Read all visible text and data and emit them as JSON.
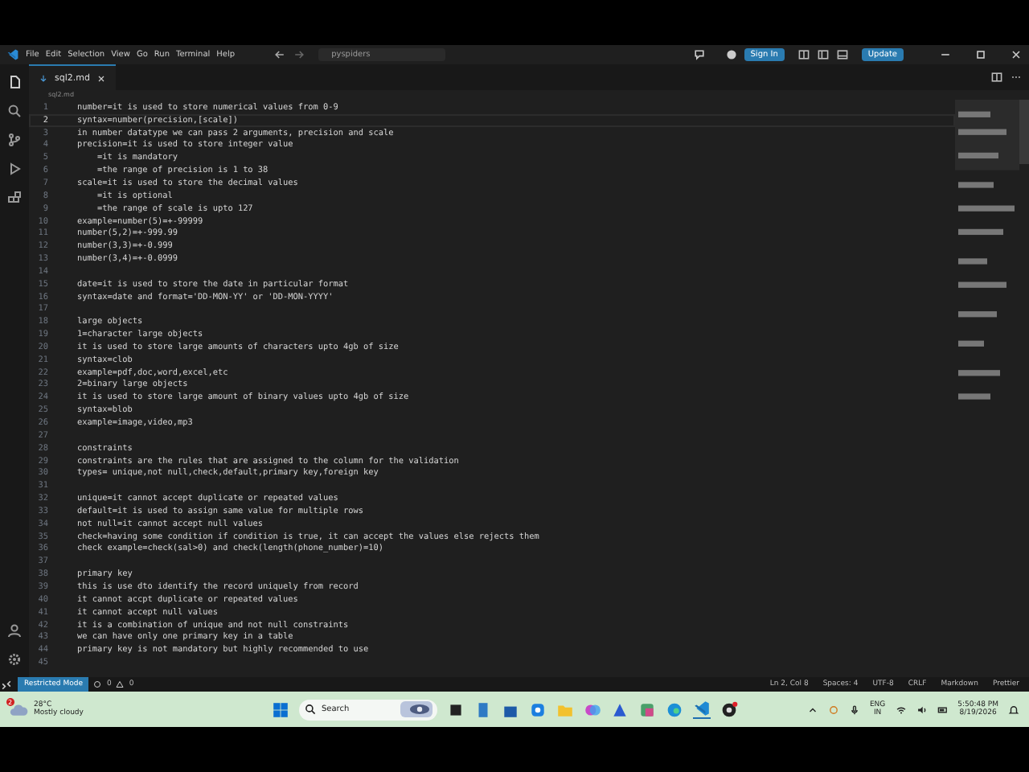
{
  "title_bar": {
    "menu": [
      "File",
      "Edit",
      "Selection",
      "View",
      "Go",
      "Run",
      "Terminal",
      "Help"
    ],
    "search": "pyspiders",
    "sign_in": "Sign In",
    "update": "Update"
  },
  "tabs": [
    {
      "label": "sql2.md",
      "selected": true
    }
  ],
  "breadcrumb": "sql2.md",
  "editor": {
    "lines": [
      {
        "number": "1",
        "text": "number=it is used to store numerical values from 0-9",
        "current": false
      },
      {
        "number": "2",
        "text": "syntax=number(precision,[scale])",
        "current": true
      },
      {
        "number": "3",
        "text": "in number datatype we can pass 2 arguments, precision and scale",
        "current": false
      },
      {
        "number": "4",
        "text": "precision=it is used to store integer value",
        "current": false
      },
      {
        "number": "5",
        "text": "    =it is mandatory",
        "current": false
      },
      {
        "number": "6",
        "text": "    =the range of precision is 1 to 38",
        "current": false
      },
      {
        "number": "7",
        "text": "scale=it is used to store the decimal values",
        "current": false
      },
      {
        "number": "8",
        "text": "    =it is optional",
        "current": false
      },
      {
        "number": "9",
        "text": "    =the range of scale is upto 127",
        "current": false
      },
      {
        "number": "10",
        "text": "example=number(5)=+-99999",
        "current": false
      },
      {
        "number": "11",
        "text": "number(5,2)=+-999.99",
        "current": false
      },
      {
        "number": "12",
        "text": "number(3,3)=+-0.999",
        "current": false
      },
      {
        "number": "13",
        "text": "number(3,4)=+-0.0999",
        "current": false
      },
      {
        "number": "14",
        "current": false
      },
      {
        "number": "15",
        "text": "date=it is used to store the date in particular format",
        "current": false
      },
      {
        "number": "16",
        "text": "syntax=date and format='DD-MON-YY' or 'DD-MON-YYYY'",
        "current": false
      },
      {
        "number": "17",
        "current": false
      },
      {
        "number": "18",
        "text": "large objects",
        "current": false
      },
      {
        "number": "19",
        "text": "1=character large objects",
        "current": false
      },
      {
        "number": "20",
        "text": "it is used to store large amounts of characters upto 4gb of size",
        "current": false
      },
      {
        "number": "21",
        "text": "syntax=clob",
        "current": false
      },
      {
        "number": "22",
        "text": "example=pdf,doc,word,excel,etc",
        "current": false
      },
      {
        "number": "23",
        "text": "2=binary large objects",
        "current": false
      },
      {
        "number": "24",
        "text": "it is used to store large amount of binary values upto 4gb of size",
        "current": false
      },
      {
        "number": "25",
        "text": "syntax=blob",
        "current": false
      },
      {
        "number": "26",
        "text": "example=image,video,mp3",
        "current": false
      },
      {
        "number": "27",
        "current": false
      },
      {
        "number": "28",
        "text": "constraints",
        "current": false
      },
      {
        "number": "29",
        "text": "constraints are the rules that are assigned to the column for the validation",
        "current": false
      },
      {
        "number": "30",
        "text": "types= unique,not null,check,default,primary key,foreign key",
        "current": false
      },
      {
        "number": "31",
        "current": false
      },
      {
        "number": "32",
        "text": "unique=it cannot accept duplicate or repeated values",
        "current": false
      },
      {
        "number": "33",
        "text": "default=it is used to assign same value for multiple rows",
        "current": false
      },
      {
        "number": "34",
        "text": "not null=it cannot accept null values",
        "current": false
      },
      {
        "number": "35",
        "text": "check=having some condition if condition is true, it can accept the values else rejects them",
        "current": false
      },
      {
        "number": "36",
        "text": "check example=check(sal>0) and check(length(phone_number)=10)",
        "current": false
      },
      {
        "number": "37",
        "current": false
      },
      {
        "number": "38",
        "text": "primary key",
        "current": false
      },
      {
        "number": "39",
        "text": "this is use dto identify the record uniquely from record",
        "current": false
      },
      {
        "number": "40",
        "text": "it cannot accpt duplicate or repeated values",
        "current": false
      },
      {
        "number": "41",
        "text": "it cannot accept null values",
        "current": false
      },
      {
        "number": "42",
        "text": "it is a combination of unique and not null constraints",
        "current": false
      },
      {
        "number": "43",
        "text": "we can have only one primary key in a table",
        "current": false
      },
      {
        "number": "44",
        "text": "primary key is not mandatory but highly recommended to use",
        "current": false
      },
      {
        "number": "45",
        "current": false
      }
    ]
  },
  "status_bar": {
    "mode": "Restricted Mode",
    "errors": "0",
    "warnings": "0",
    "right": [
      "Ln 2, Col 8",
      "Spaces: 4",
      "UTF-8",
      "CRLF",
      "Markdown",
      "Prettier"
    ]
  },
  "taskbar": {
    "weather": {
      "badge": "2",
      "temperature": "28°C",
      "condition": "Mostly cloudy"
    },
    "search": "Search",
    "language": "ENG",
    "region": "IN",
    "time": "5:50:48 PM",
    "date": "8/19/2026"
  }
}
